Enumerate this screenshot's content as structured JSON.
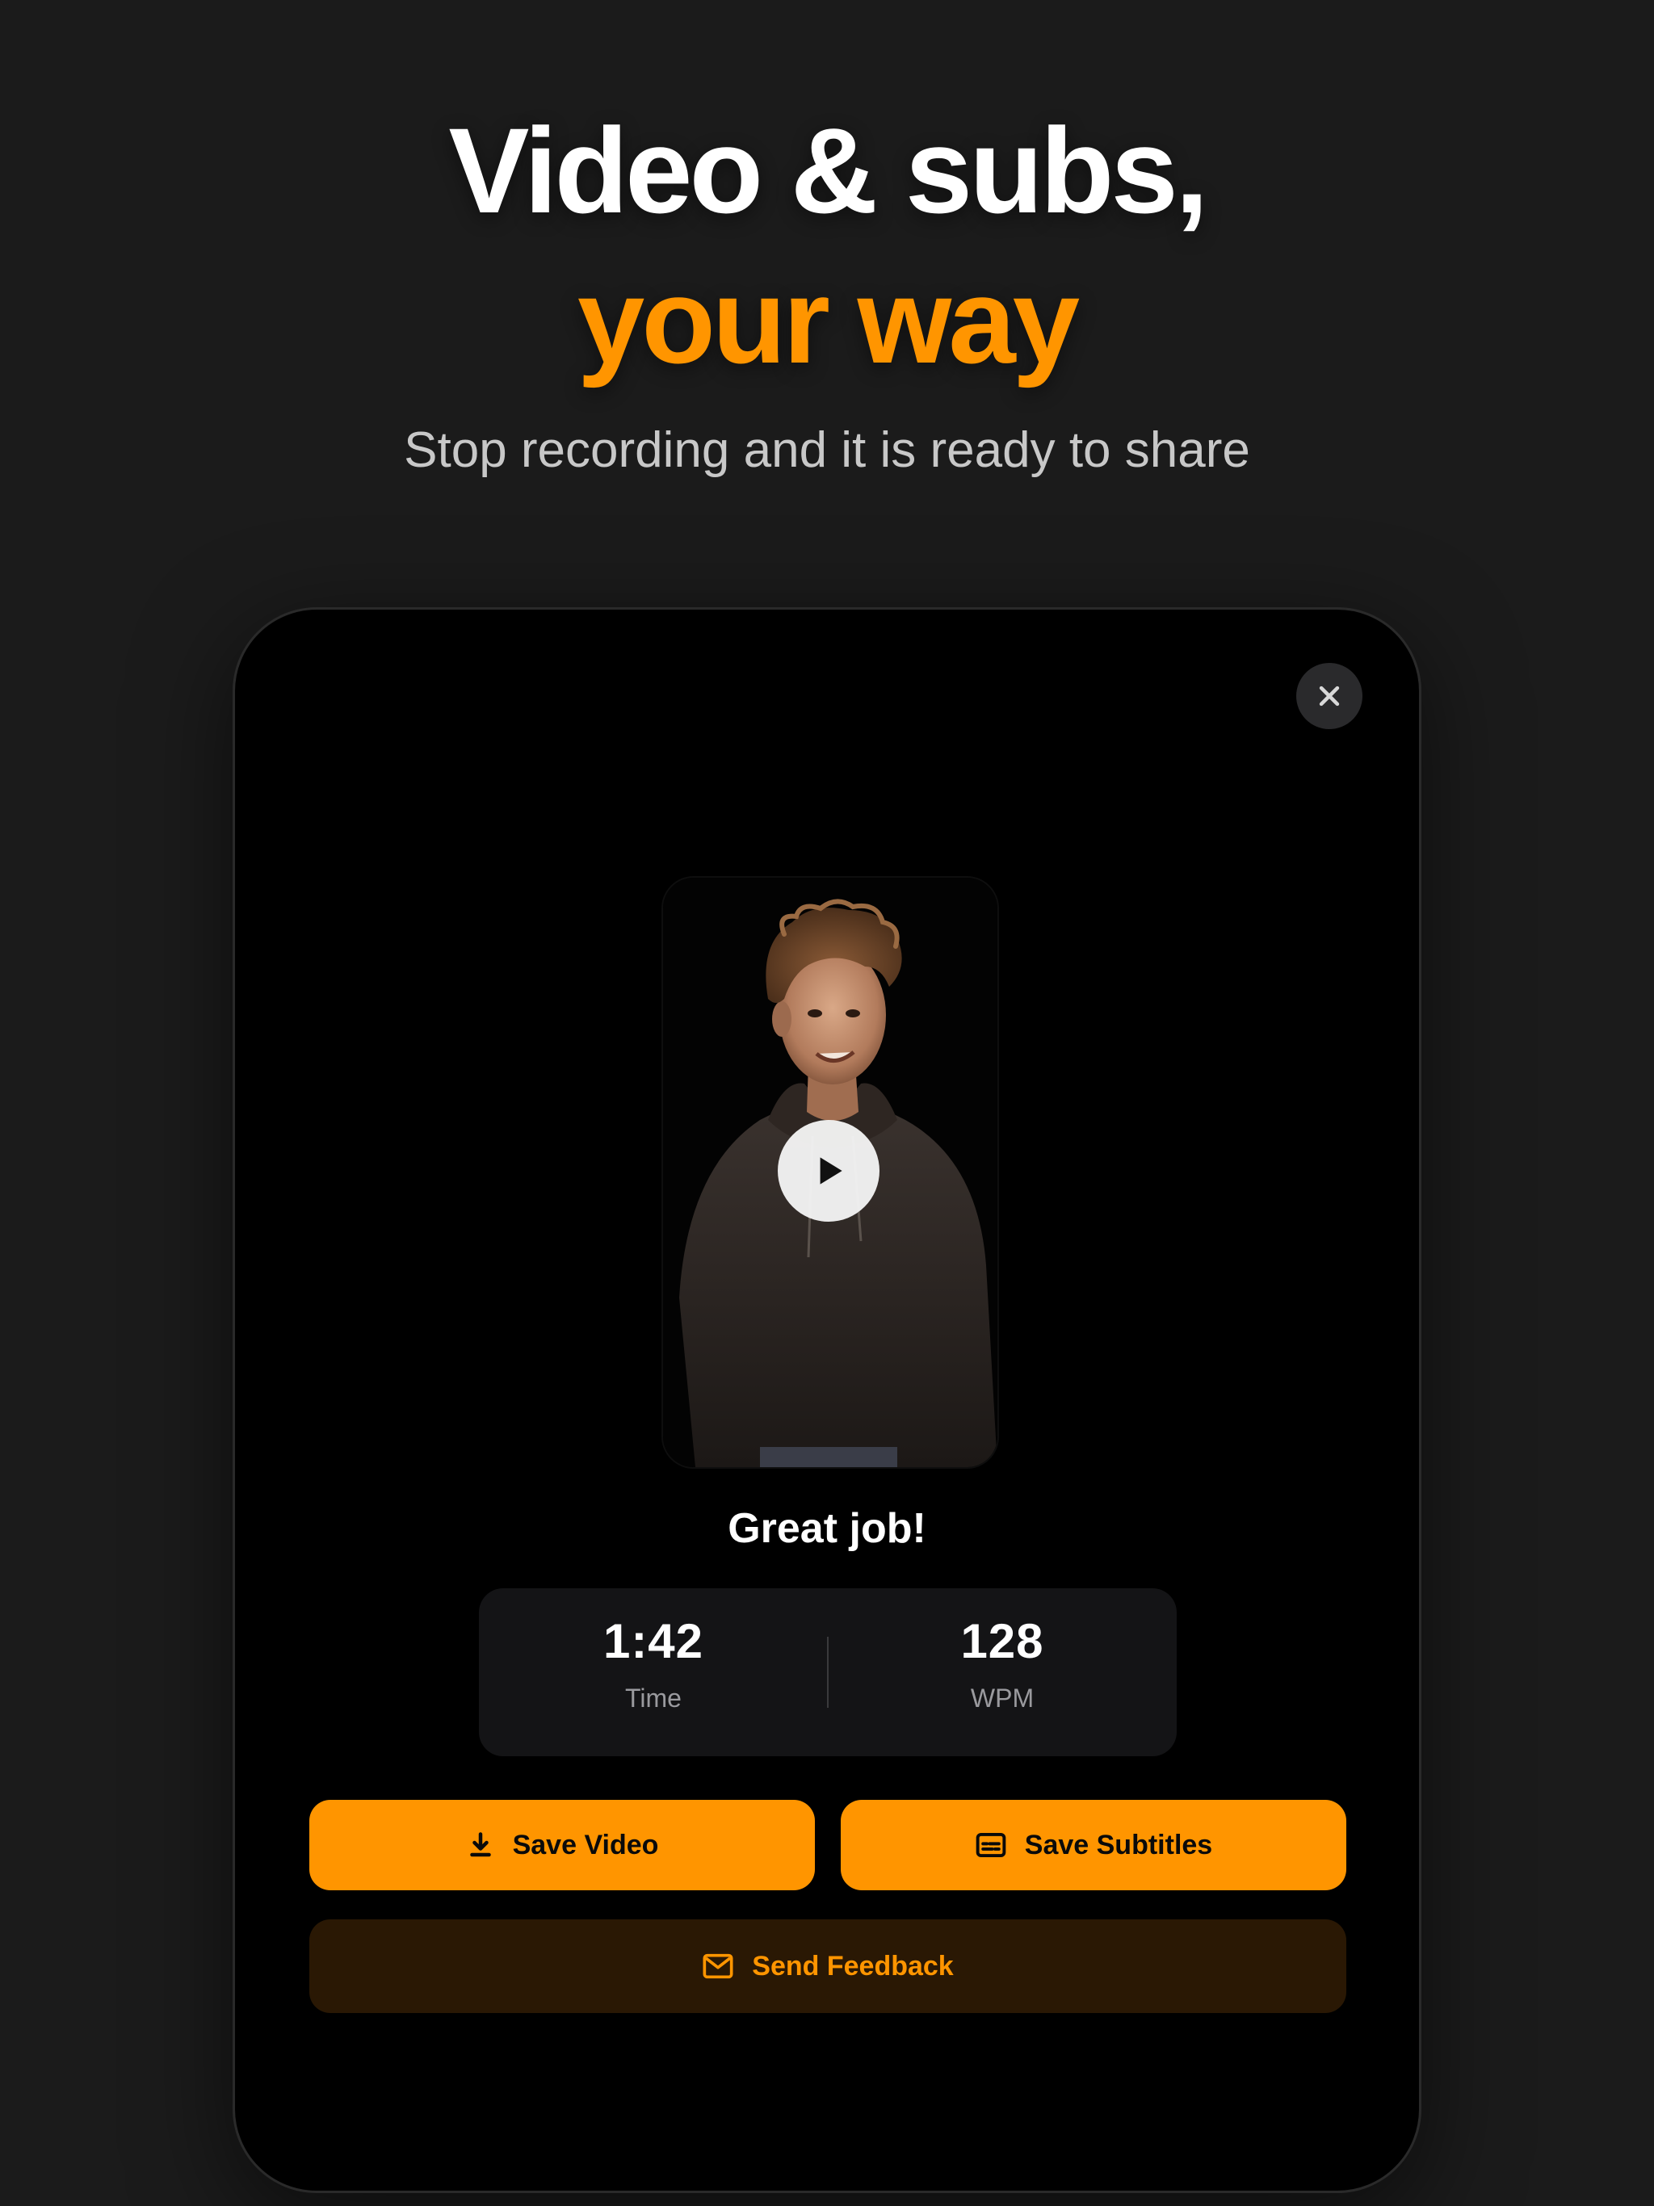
{
  "hero": {
    "line1": "Video & subs,",
    "line2": "your way",
    "subtitle": "Stop recording and it is ready to share"
  },
  "modal": {
    "heading": "Great job!",
    "stats": [
      {
        "value": "1:42",
        "label": "Time"
      },
      {
        "value": "128",
        "label": "WPM"
      }
    ],
    "buttons": {
      "save_video": "Save Video",
      "save_subtitles": "Save Subtitles",
      "send_feedback": "Send Feedback"
    }
  },
  "icons": {
    "close": "close-icon",
    "play": "play-icon",
    "download": "download-icon",
    "subtitles": "subtitles-icon",
    "mail": "mail-icon"
  },
  "colors": {
    "accent": "#ff9500",
    "background": "#1b1b1b",
    "card": "#000000",
    "stats_bg": "#141416",
    "feedback_bg": "#2a1804"
  }
}
